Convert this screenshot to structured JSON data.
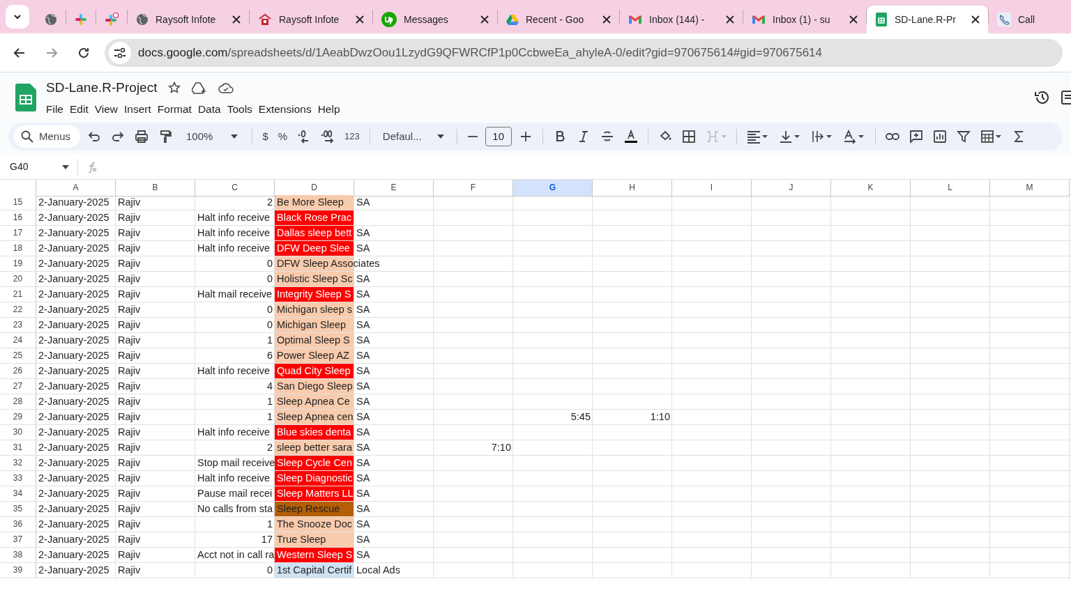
{
  "browser": {
    "tabs": [
      {
        "kind": "globe",
        "selected": false
      },
      {
        "kind": "hash",
        "selected": false
      },
      {
        "kind": "hash-badge",
        "selected": false
      },
      {
        "kind": "globe",
        "title": "Raysoft Infote",
        "selected": false
      },
      {
        "kind": "house",
        "title": "Raysoft Infote",
        "selected": false
      },
      {
        "kind": "green-circle",
        "title": "Messages",
        "selected": false
      },
      {
        "kind": "triangle",
        "title": "Recent - Goo",
        "selected": false
      },
      {
        "kind": "envelope",
        "title": "Inbox (144) -",
        "selected": false
      },
      {
        "kind": "envelope",
        "title": "Inbox (1) - su",
        "selected": false
      },
      {
        "kind": "sheet",
        "title": "SD-Lane.R-Pr",
        "selected": true
      },
      {
        "kind": "phone",
        "title": "Call",
        "selected": false
      }
    ],
    "url_host": "docs.google.com",
    "url_path": "/spreadsheets/d/1AeabDwzOou1LzydG9QFWRCfP1p0CcbweEa_ahyleA-0/edit?gid=970675614#gid=970675614"
  },
  "document": {
    "title": "SD-Lane.R-Project",
    "menus": [
      "File",
      "Edit",
      "View",
      "Insert",
      "Format",
      "Data",
      "Tools",
      "Extensions",
      "Help"
    ]
  },
  "toolbar": {
    "search": "Menus",
    "zoom": "100%",
    "currency": "$",
    "percent": "%",
    "number_format": "123",
    "font": "Defaul...",
    "font_size": "10"
  },
  "formula_bar": {
    "cell_ref": "G40"
  },
  "sheet": {
    "columns": [
      {
        "label": "A",
        "selected": false
      },
      {
        "label": "B",
        "selected": false
      },
      {
        "label": "C",
        "selected": false
      },
      {
        "label": "D",
        "selected": false
      },
      {
        "label": "E",
        "selected": false
      },
      {
        "label": "F",
        "selected": false
      },
      {
        "label": "G",
        "selected": true
      },
      {
        "label": "H",
        "selected": false
      },
      {
        "label": "I",
        "selected": false
      },
      {
        "label": "J",
        "selected": false
      },
      {
        "label": "K",
        "selected": false
      },
      {
        "label": "L",
        "selected": false
      },
      {
        "label": "M",
        "selected": false
      }
    ],
    "rows": [
      {
        "number": "15",
        "cells": {
          "A": {
            "text": "2-January-2025"
          },
          "B": {
            "text": "Rajiv"
          },
          "C": {
            "text": "2",
            "kind": "number"
          },
          "D": {
            "text": "Be More Sleep",
            "color": "#f8cbad"
          },
          "E": {
            "text": "SA"
          }
        }
      },
      {
        "number": "16",
        "cells": {
          "A": {
            "text": "2-January-2025"
          },
          "B": {
            "text": "Rajiv"
          },
          "C": {
            "text": "Halt info receive"
          },
          "D": {
            "text": "Black Rose Prac",
            "color": "#ff0000"
          }
        }
      },
      {
        "number": "17",
        "cells": {
          "A": {
            "text": "2-January-2025"
          },
          "B": {
            "text": "Rajiv"
          },
          "C": {
            "text": "Halt info receive"
          },
          "D": {
            "text": "Dallas sleep bett",
            "color": "#ff0000"
          },
          "E": {
            "text": "SA"
          }
        }
      },
      {
        "number": "18",
        "cells": {
          "A": {
            "text": "2-January-2025"
          },
          "B": {
            "text": "Rajiv"
          },
          "C": {
            "text": "Halt info receive"
          },
          "D": {
            "text": "DFW Deep Slee",
            "color": "#ff0000"
          },
          "E": {
            "text": "SA"
          }
        }
      },
      {
        "number": "19",
        "cells": {
          "A": {
            "text": "2-January-2025"
          },
          "B": {
            "text": "Rajiv"
          },
          "C": {
            "text": "0",
            "kind": "number"
          },
          "D": {
            "text": "DFW Sleep Associates",
            "color": "#f8cbad"
          }
        }
      },
      {
        "number": "20",
        "cells": {
          "A": {
            "text": "2-January-2025"
          },
          "B": {
            "text": "Rajiv"
          },
          "C": {
            "text": "0",
            "kind": "number"
          },
          "D": {
            "text": "Holistic Sleep Sc",
            "color": "#f8cbad"
          },
          "E": {
            "text": "SA"
          }
        }
      },
      {
        "number": "21",
        "cells": {
          "A": {
            "text": "2-January-2025"
          },
          "B": {
            "text": "Rajiv"
          },
          "C": {
            "text": "Halt mail receive"
          },
          "D": {
            "text": "Integrity Sleep S",
            "color": "#ff0000"
          },
          "E": {
            "text": "SA"
          }
        }
      },
      {
        "number": "22",
        "cells": {
          "A": {
            "text": "2-January-2025"
          },
          "B": {
            "text": "Rajiv"
          },
          "C": {
            "text": "0",
            "kind": "number"
          },
          "D": {
            "text": "Michigan sleep s",
            "color": "#f8cbad"
          },
          "E": {
            "text": "SA"
          }
        }
      },
      {
        "number": "23",
        "cells": {
          "A": {
            "text": "2-January-2025"
          },
          "B": {
            "text": "Rajiv"
          },
          "C": {
            "text": "0",
            "kind": "number"
          },
          "D": {
            "text": "Michigan Sleep",
            "color": "#f8cbad"
          },
          "E": {
            "text": "SA"
          }
        }
      },
      {
        "number": "24",
        "cells": {
          "A": {
            "text": "2-January-2025"
          },
          "B": {
            "text": "Rajiv"
          },
          "C": {
            "text": "1",
            "kind": "number"
          },
          "D": {
            "text": "Optimal Sleep S",
            "color": "#f8cbad"
          },
          "E": {
            "text": "SA"
          }
        }
      },
      {
        "number": "25",
        "cells": {
          "A": {
            "text": "2-January-2025"
          },
          "B": {
            "text": "Rajiv"
          },
          "C": {
            "text": "6",
            "kind": "number"
          },
          "D": {
            "text": "Power Sleep AZ",
            "color": "#f8cbad"
          },
          "E": {
            "text": "SA"
          }
        }
      },
      {
        "number": "26",
        "cells": {
          "A": {
            "text": "2-January-2025"
          },
          "B": {
            "text": "Rajiv"
          },
          "C": {
            "text": "Halt info receive"
          },
          "D": {
            "text": "Quad City Sleep",
            "color": "#ff0000"
          },
          "E": {
            "text": "SA"
          }
        }
      },
      {
        "number": "27",
        "cells": {
          "A": {
            "text": "2-January-2025"
          },
          "B": {
            "text": "Rajiv"
          },
          "C": {
            "text": "4",
            "kind": "number"
          },
          "D": {
            "text": "San Diego Sleep",
            "color": "#f8cbad"
          },
          "E": {
            "text": "SA"
          }
        }
      },
      {
        "number": "28",
        "cells": {
          "A": {
            "text": "2-January-2025"
          },
          "B": {
            "text": "Rajiv"
          },
          "C": {
            "text": "1",
            "kind": "number"
          },
          "D": {
            "text": "Sleep Apnea Ce",
            "color": "#f8cbad"
          },
          "E": {
            "text": "SA"
          }
        }
      },
      {
        "number": "29",
        "cells": {
          "A": {
            "text": "2-January-2025"
          },
          "B": {
            "text": "Rajiv"
          },
          "C": {
            "text": "1",
            "kind": "number"
          },
          "D": {
            "text": "Sleep Apnea cen",
            "color": "#f8cbad"
          },
          "E": {
            "text": "SA"
          },
          "G": {
            "text": "5:45",
            "kind": "number"
          },
          "H": {
            "text": "1:10",
            "kind": "number"
          }
        }
      },
      {
        "number": "30",
        "cells": {
          "A": {
            "text": "2-January-2025"
          },
          "B": {
            "text": "Rajiv"
          },
          "C": {
            "text": "Halt info receive"
          },
          "D": {
            "text": "Blue skies denta",
            "color": "#ff0000"
          },
          "E": {
            "text": "SA"
          }
        }
      },
      {
        "number": "31",
        "cells": {
          "A": {
            "text": "2-January-2025"
          },
          "B": {
            "text": "Rajiv"
          },
          "C": {
            "text": "2",
            "kind": "number"
          },
          "D": {
            "text": "sleep better sara",
            "color": "#f8cbad"
          },
          "E": {
            "text": "SA"
          },
          "F": {
            "text": "7:10",
            "kind": "number"
          }
        }
      },
      {
        "number": "32",
        "cells": {
          "A": {
            "text": "2-January-2025"
          },
          "B": {
            "text": "Rajiv"
          },
          "C": {
            "text": "Stop mail receive"
          },
          "D": {
            "text": "Sleep Cycle Cen",
            "color": "#ff0000"
          },
          "E": {
            "text": "SA"
          }
        }
      },
      {
        "number": "33",
        "cells": {
          "A": {
            "text": "2-January-2025"
          },
          "B": {
            "text": "Rajiv"
          },
          "C": {
            "text": "Halt info receive"
          },
          "D": {
            "text": "Sleep Diagnostic",
            "color": "#ff0000"
          },
          "E": {
            "text": "SA"
          }
        }
      },
      {
        "number": "34",
        "cells": {
          "A": {
            "text": "2-January-2025"
          },
          "B": {
            "text": "Rajiv"
          },
          "C": {
            "text": "Pause mail recei"
          },
          "D": {
            "text": "Sleep Matters LL",
            "color": "#ff0000"
          },
          "E": {
            "text": "SA"
          }
        }
      },
      {
        "number": "35",
        "cells": {
          "A": {
            "text": "2-January-2025"
          },
          "B": {
            "text": "Rajiv"
          },
          "C": {
            "text": "No calls from sta"
          },
          "D": {
            "text": "Sleep Rescue",
            "color": "#b45f06"
          },
          "E": {
            "text": "SA"
          }
        }
      },
      {
        "number": "36",
        "cells": {
          "A": {
            "text": "2-January-2025"
          },
          "B": {
            "text": "Rajiv"
          },
          "C": {
            "text": "1",
            "kind": "number"
          },
          "D": {
            "text": "The Snooze Doc",
            "color": "#f8cbad"
          },
          "E": {
            "text": "SA"
          }
        }
      },
      {
        "number": "37",
        "cells": {
          "A": {
            "text": "2-January-2025"
          },
          "B": {
            "text": "Rajiv"
          },
          "C": {
            "text": "17",
            "kind": "number"
          },
          "D": {
            "text": "True Sleep",
            "color": "#f8cbad"
          },
          "E": {
            "text": "SA"
          }
        }
      },
      {
        "number": "38",
        "cells": {
          "A": {
            "text": "2-January-2025"
          },
          "B": {
            "text": "Rajiv"
          },
          "C": {
            "text": "Acct not in call ra"
          },
          "D": {
            "text": "Western Sleep S",
            "color": "#ff0000"
          },
          "E": {
            "text": "SA"
          }
        }
      },
      {
        "number": "39",
        "cells": {
          "A": {
            "text": "2-January-2025"
          },
          "B": {
            "text": "Rajiv"
          },
          "C": {
            "text": "0",
            "kind": "number"
          },
          "D": {
            "text": "1st Capital Certif",
            "color": "#cfe2f3"
          },
          "E": {
            "text": "Local Ads"
          }
        }
      }
    ]
  }
}
